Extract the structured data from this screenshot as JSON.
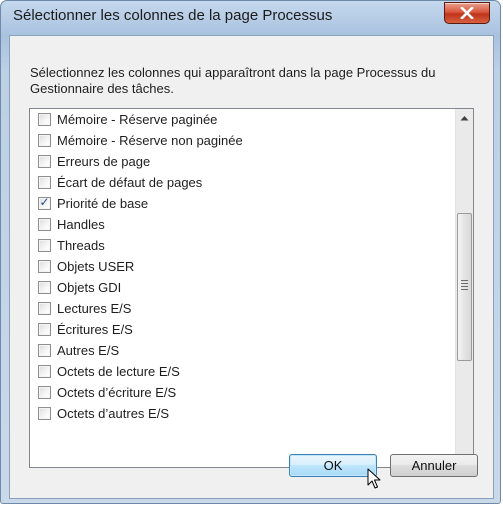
{
  "dialog": {
    "title": "Sélectionner les colonnes de la page Processus",
    "description": "Sélectionnez les colonnes qui apparaîtront dans la page Processus du Gestionnaire des tâches."
  },
  "columns": [
    {
      "label": "Mémoire - Réserve paginée",
      "checked": false
    },
    {
      "label": "Mémoire - Réserve non paginée",
      "checked": false
    },
    {
      "label": "Erreurs de page",
      "checked": false
    },
    {
      "label": "Écart de défaut de pages",
      "checked": false
    },
    {
      "label": "Priorité de base",
      "checked": true
    },
    {
      "label": "Handles",
      "checked": false
    },
    {
      "label": "Threads",
      "checked": false
    },
    {
      "label": "Objets USER",
      "checked": false
    },
    {
      "label": "Objets GDI",
      "checked": false
    },
    {
      "label": "Lectures E/S",
      "checked": false
    },
    {
      "label": "Écritures E/S",
      "checked": false
    },
    {
      "label": "Autres E/S",
      "checked": false
    },
    {
      "label": "Octets de lecture E/S",
      "checked": false
    },
    {
      "label": "Octets d’écriture E/S",
      "checked": false
    },
    {
      "label": "Octets d’autres E/S",
      "checked": false
    }
  ],
  "buttons": {
    "ok": "OK",
    "cancel": "Annuler"
  },
  "icons": {
    "close": "close-icon",
    "scroll_up": "scroll-up-arrow-icon",
    "scroll_down": "scroll-down-arrow-icon",
    "cursor": "mouse-pointer-icon"
  }
}
